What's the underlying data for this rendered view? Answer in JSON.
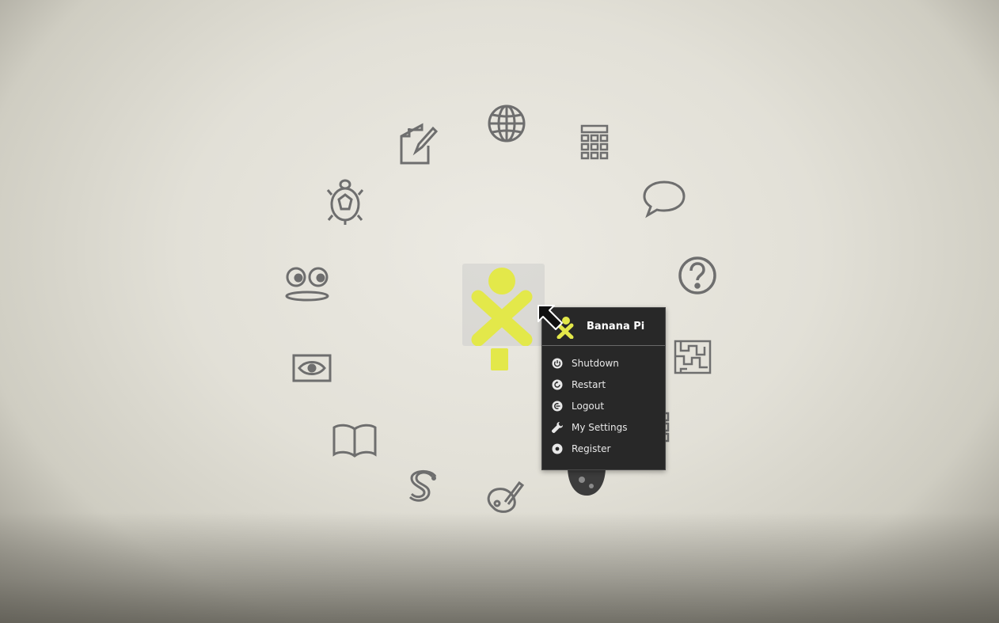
{
  "palette": {
    "title": "Banana Pi",
    "items": [
      {
        "label": "Shutdown",
        "icon": "power-icon"
      },
      {
        "label": "Restart",
        "icon": "restart-icon"
      },
      {
        "label": "Logout",
        "icon": "logout-icon"
      },
      {
        "label": "My Settings",
        "icon": "wrench-icon"
      },
      {
        "label": "Register",
        "icon": "register-icon"
      }
    ]
  },
  "activities": [
    "write-icon",
    "browse-globe-icon",
    "calculator-icon",
    "chat-icon",
    "help-icon",
    "maze-icon",
    "grid-icon",
    "moon-icon",
    "paint-icon",
    "pippy-snake-icon",
    "read-book-icon",
    "record-eye-icon",
    "speak-face-icon",
    "turtle-icon"
  ],
  "colors": {
    "xo_fill": "#e3e84a",
    "icon_stroke": "#6e6e6e",
    "palette_bg": "#282828"
  }
}
